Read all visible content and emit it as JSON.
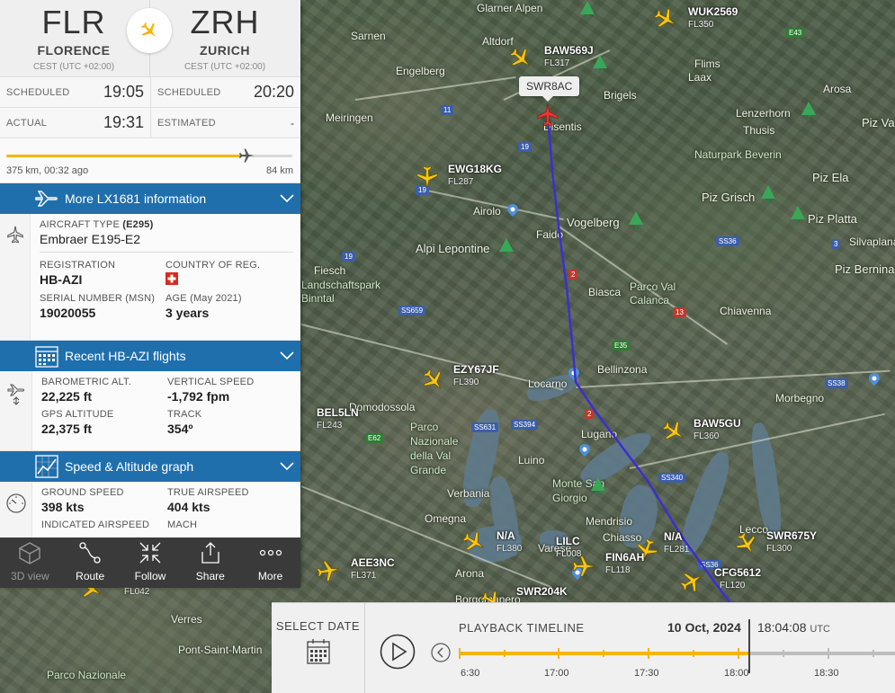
{
  "route": {
    "from": {
      "code": "FLR",
      "city": "FLORENCE",
      "tz": "CEST (UTC +02:00)"
    },
    "to": {
      "code": "ZRH",
      "city": "ZURICH",
      "tz": "CEST (UTC +02:00)"
    }
  },
  "times": {
    "scheduled_label": "SCHEDULED",
    "dep_scheduled": "19:05",
    "arr_scheduled": "20:20",
    "actual_label": "ACTUAL",
    "dep_actual": "19:31",
    "estimated_label": "ESTIMATED",
    "arr_estimated": "-"
  },
  "progress": {
    "flown": "375 km, 00:32 ago",
    "remaining": "84 km",
    "fraction": 0.82
  },
  "sections": {
    "more_info": "More LX1681 information",
    "recent": "Recent HB-AZI flights",
    "graph": "Speed & Altitude graph"
  },
  "aircraft": {
    "type_label": "AIRCRAFT TYPE",
    "type_code": "(E295)",
    "type_value": "Embraer E195-E2",
    "reg_label": "REGISTRATION",
    "reg_value": "HB-AZI",
    "country_label": "COUNTRY OF REG.",
    "msn_label": "SERIAL NUMBER (MSN)",
    "msn_value": "19020055",
    "age_label": "AGE (May 2021)",
    "age_value": "3 years"
  },
  "telemetry": {
    "baro_label": "BAROMETRIC ALT.",
    "baro_value": "22,225 ft",
    "vs_label": "VERTICAL SPEED",
    "vs_value": "-1,792 fpm",
    "gps_label": "GPS ALTITUDE",
    "gps_value": "22,375 ft",
    "track_label": "TRACK",
    "track_value": "354º"
  },
  "speed": {
    "gs_label": "GROUND SPEED",
    "gs_value": "398 kts",
    "tas_label": "TRUE AIRSPEED",
    "tas_value": "404 kts",
    "ias_label": "INDICATED AIRSPEED",
    "mach_label": "MACH"
  },
  "toolbar": {
    "view3d": "3D view",
    "route": "Route",
    "follow": "Follow",
    "share": "Share",
    "more": "More"
  },
  "playback": {
    "select_date": "SELECT DATE",
    "title": "PLAYBACK TIMELINE",
    "date": "10 Oct, 2024",
    "time": "18:04:08",
    "tz": "UTC",
    "ticks": [
      "6:30",
      "17:00",
      "17:30",
      "18:00",
      "18:30"
    ]
  },
  "map": {
    "selected_callsign": "SWR8AC",
    "flights": [
      {
        "callsign": "WUK2569",
        "fl": "FL350"
      },
      {
        "callsign": "BAW569J",
        "fl": "FL317"
      },
      {
        "callsign": "EWG18KG",
        "fl": "FL287"
      },
      {
        "callsign": "EZY67JF",
        "fl": "FL390"
      },
      {
        "callsign": "BEL5LN",
        "fl": "FL243"
      },
      {
        "callsign": "BAW5GU",
        "fl": "FL360"
      },
      {
        "callsign": "N/A",
        "fl": "FL380"
      },
      {
        "callsign": "LILC",
        "fl": "FL008"
      },
      {
        "callsign": "FIN6AH",
        "fl": "FL118"
      },
      {
        "callsign": "N/A",
        "fl": "FL281"
      },
      {
        "callsign": "SWR675Y",
        "fl": "FL300"
      },
      {
        "callsign": "CFG5612",
        "fl": "FL120"
      },
      {
        "callsign": "AEE3NC",
        "fl": "FL371"
      },
      {
        "callsign": "SWR204K",
        "fl": ""
      },
      {
        "callsign": "",
        "fl": "FL042"
      }
    ],
    "places": [
      "Glarner Alpen",
      "Sarnen",
      "Altdorf",
      "Flims",
      "Laax",
      "Brigels",
      "Arosa",
      "Lenzerhorn",
      "Thusis",
      "Piz Vag",
      "Meiringen",
      "Engelberg",
      "Disentis",
      "Naturpark Beverin",
      "Piz Grisch",
      "Piz Ela",
      "Airolo",
      "Vogelberg",
      "Faido",
      "Alpi Lepontine",
      "Piz Platta",
      "Silvaplana",
      "Piz Bernina",
      "Fiesch",
      "Landschaftspark Binntal",
      "Biasca",
      "Parco Val Calanca",
      "Chiavenna",
      "Bellinzona",
      "Locarno",
      "Domodossola",
      "Morbegno",
      "Parco Nazionale della Val Grande",
      "Lugano",
      "Luino",
      "Monte San Giorgio",
      "Verbania",
      "Omegna",
      "Mendrisio",
      "Chiasso",
      "Varese",
      "Lecco",
      "Arona",
      "Borgomanero",
      "Verres",
      "Pont-Saint-Martin",
      "Parco Nazionale"
    ]
  },
  "colors": {
    "accent": "#1f6fad",
    "progress": "#f5b50a",
    "selected_plane": "#e53935",
    "plane": "#f5c518",
    "track": "#3b2fd0"
  }
}
